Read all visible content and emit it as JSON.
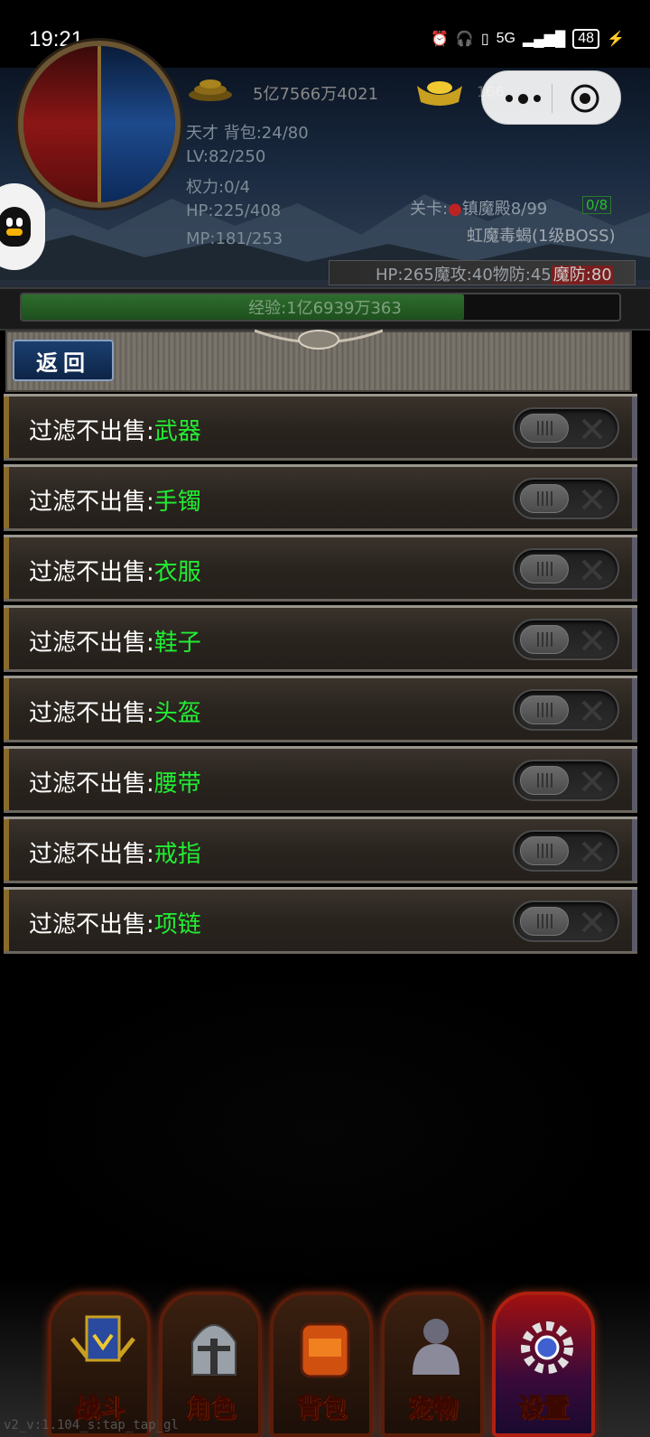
{
  "status_bar": {
    "time": "19:21",
    "network": "5G",
    "battery": "48",
    "icons": [
      "alarm-icon",
      "headphones-icon",
      "battery-saver-icon",
      "signal-icon",
      "battery-icon",
      "charging-icon"
    ]
  },
  "player": {
    "gold": "5亿7566万4021",
    "ingot_count": "166",
    "title_bag": "天才 背包:24/80",
    "level": "LV:82/250",
    "power": "权力:0/4",
    "hp": "HP:225/408",
    "mp": "MP:181/253",
    "exp_text": "经验:1亿6939万363",
    "exp_progress": 0.74
  },
  "stage": {
    "label": "关卡:",
    "name": "镇魔殿8/99",
    "tag": "0/8",
    "boss": "虹魔毒蝎(1级BOSS)",
    "monster_stats": "HP:265魔攻:40物防:45",
    "monster_mdef": "魔防:80"
  },
  "panel": {
    "back_label": "返回"
  },
  "filters": [
    {
      "prefix": "过滤不出售:",
      "item": "武器",
      "enabled": false
    },
    {
      "prefix": "过滤不出售:",
      "item": "手镯",
      "enabled": false
    },
    {
      "prefix": "过滤不出售:",
      "item": "衣服",
      "enabled": false
    },
    {
      "prefix": "过滤不出售:",
      "item": "鞋子",
      "enabled": false
    },
    {
      "prefix": "过滤不出售:",
      "item": "头盔",
      "enabled": false
    },
    {
      "prefix": "过滤不出售:",
      "item": "腰带",
      "enabled": false
    },
    {
      "prefix": "过滤不出售:",
      "item": "戒指",
      "enabled": false
    },
    {
      "prefix": "过滤不出售:",
      "item": "项链",
      "enabled": false
    }
  ],
  "nav": {
    "items": [
      {
        "label": "战斗",
        "icon": "battle-banner-icon"
      },
      {
        "label": "角色",
        "icon": "knight-helmet-icon"
      },
      {
        "label": "背包",
        "icon": "backpack-icon"
      },
      {
        "label": "宠物",
        "icon": "gorilla-pet-icon"
      },
      {
        "label": "设置",
        "icon": "gear-icon"
      }
    ],
    "active": "设置"
  },
  "version": "v2_v:1.104_s:tap_tap_gl",
  "colors": {
    "filter_item": "#22ee33",
    "exp_fill": "#2e6d2e",
    "nav_label": "#e8a020",
    "nav_active": "#ff4030"
  }
}
